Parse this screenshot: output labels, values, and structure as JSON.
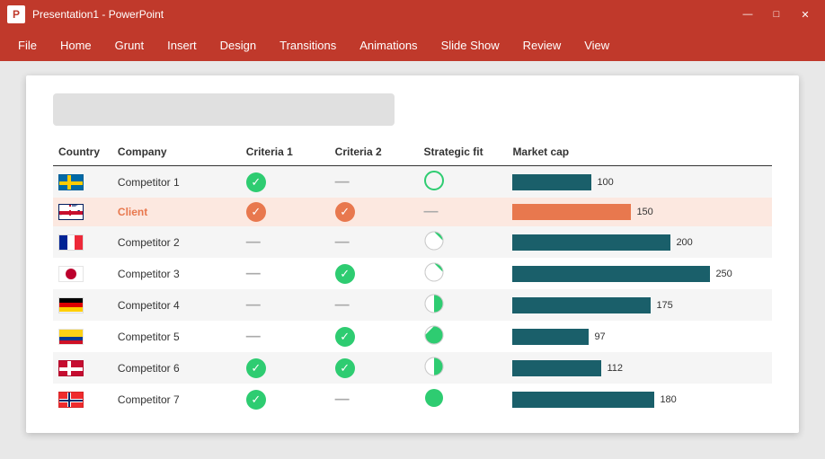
{
  "titlebar": {
    "app_icon": "P",
    "title": "Presentation1 - PowerPoint",
    "min_btn": "—",
    "max_btn": "□",
    "close_btn": "✕"
  },
  "menubar": {
    "items": [
      "File",
      "Home",
      "Grunt",
      "Insert",
      "Design",
      "Transitions",
      "Animations",
      "Slide Show",
      "Review",
      "View"
    ]
  },
  "slide": {
    "title_placeholder": "",
    "table": {
      "headers": [
        "Country",
        "Company",
        "Criteria 1",
        "Criteria 2",
        "Strategic fit",
        "Market cap"
      ],
      "rows": [
        {
          "country_flag": "se",
          "company": "Competitor 1",
          "company_style": "normal",
          "criteria1": "check",
          "criteria2": "dash",
          "strategic": "empty-circle",
          "bar_value": 100,
          "bar_max": 250,
          "bar_style": "dark"
        },
        {
          "country_flag": "gb",
          "company": "Client",
          "company_style": "orange",
          "criteria1": "check-orange",
          "criteria2": "check-orange",
          "strategic": "dash",
          "bar_value": 150,
          "bar_max": 250,
          "bar_style": "orange"
        },
        {
          "country_flag": "fr",
          "company": "Competitor 2",
          "company_style": "normal",
          "criteria1": "dash",
          "criteria2": "dash",
          "strategic": "pie-quarter",
          "bar_value": 200,
          "bar_max": 250,
          "bar_style": "dark"
        },
        {
          "country_flag": "jp",
          "company": "Competitor 3",
          "company_style": "normal",
          "criteria1": "dash",
          "criteria2": "check",
          "strategic": "pie-quarter",
          "bar_value": 250,
          "bar_max": 250,
          "bar_style": "dark"
        },
        {
          "country_flag": "de",
          "company": "Competitor 4",
          "company_style": "normal",
          "criteria1": "dash",
          "criteria2": "dash",
          "strategic": "pie-half",
          "bar_value": 175,
          "bar_max": 250,
          "bar_style": "dark"
        },
        {
          "country_flag": "co",
          "company": "Competitor 5",
          "company_style": "normal",
          "criteria1": "dash",
          "criteria2": "check",
          "strategic": "pie-three-quarter",
          "bar_value": 97,
          "bar_max": 250,
          "bar_style": "dark"
        },
        {
          "country_flag": "dk",
          "company": "Competitor 6",
          "company_style": "normal",
          "criteria1": "check",
          "criteria2": "check",
          "strategic": "pie-half",
          "bar_value": 112,
          "bar_max": 250,
          "bar_style": "dark"
        },
        {
          "country_flag": "no",
          "company": "Competitor 7",
          "company_style": "normal",
          "criteria1": "check",
          "criteria2": "dash",
          "strategic": "pie-full",
          "bar_value": 180,
          "bar_max": 250,
          "bar_style": "dark"
        }
      ]
    }
  }
}
